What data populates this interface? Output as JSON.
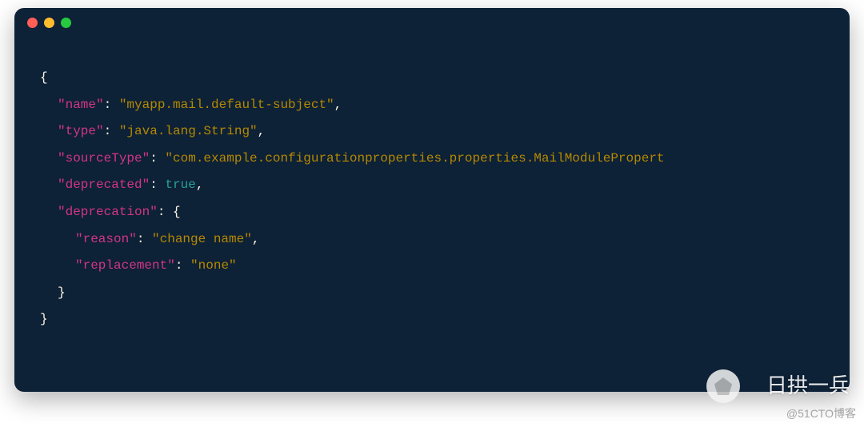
{
  "code": {
    "open_brace": "{",
    "close_brace": "}",
    "name_key": "\"name\"",
    "name_val": "\"myapp.mail.default-subject\"",
    "type_key": "\"type\"",
    "type_val": "\"java.lang.String\"",
    "sourceType_key": "\"sourceType\"",
    "sourceType_val": "\"com.example.configurationproperties.properties.MailModulePropert",
    "deprecated_key": "\"deprecated\"",
    "deprecated_val": "true",
    "deprecation_key": "\"deprecation\"",
    "reason_key": "\"reason\"",
    "reason_val": "\"change name\"",
    "replacement_key": "\"replacement\"",
    "replacement_val": "\"none\"",
    "colon": ": ",
    "colon_brace": ": {",
    "comma": ","
  },
  "watermark": {
    "text": "日拱一兵",
    "blog": "@51CTO博客"
  }
}
